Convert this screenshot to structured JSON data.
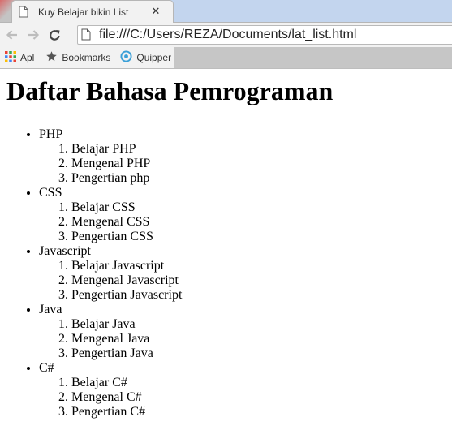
{
  "browser": {
    "tab": {
      "title": "Kuy Belajar bikin List",
      "close": "✕"
    },
    "url": "file:///C:/Users/REZA/Documents/lat_list.html",
    "bookmarks": [
      {
        "label": "Apl",
        "icon": "apps-grid-icon"
      },
      {
        "label": "Bookmarks",
        "icon": "star-icon"
      },
      {
        "label": "Quipper",
        "icon": "quipper-icon"
      }
    ]
  },
  "page": {
    "heading": "Daftar Bahasa Pemrograman",
    "languages": [
      {
        "name": "PHP",
        "items": [
          "Belajar PHP",
          "Mengenal PHP",
          "Pengertian php"
        ]
      },
      {
        "name": "CSS",
        "items": [
          "Belajar CSS",
          "Mengenal CSS",
          "Pengertian CSS"
        ]
      },
      {
        "name": "Javascript",
        "items": [
          "Belajar Javascript",
          "Mengenal Javascript",
          "Pengertian Javascript"
        ]
      },
      {
        "name": "Java",
        "items": [
          "Belajar Java",
          "Mengenal Java",
          "Pengertian Java"
        ]
      },
      {
        "name": "C#",
        "items": [
          "Belajar C#",
          "Mengenal C#",
          "Pengertian C#"
        ]
      }
    ]
  }
}
